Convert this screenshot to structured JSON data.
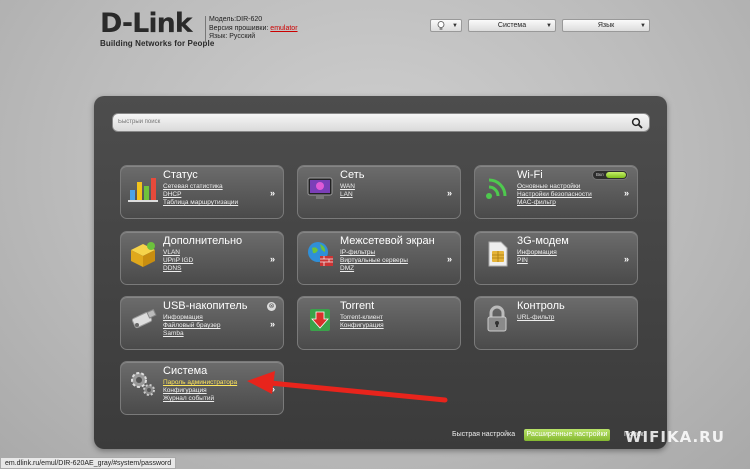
{
  "header": {
    "logo_main": "D-Link",
    "logo_sub": "Building Networks for People",
    "model_line": "Модель:DIR-620",
    "firmware_label": "Версия прошивки: ",
    "firmware_value": "emulator",
    "lang_line": "Язык: Русский"
  },
  "top_controls": {
    "system": "Система",
    "language": "Язык"
  },
  "search": {
    "placeholder": "Быстрый поиск"
  },
  "tiles": [
    {
      "title": "Статус",
      "icon": "status-chart-icon",
      "links": [
        "Сетевая статистика",
        "DHCP",
        "Таблица маршрутизации"
      ]
    },
    {
      "title": "Сеть",
      "icon": "network-monitor-icon",
      "links": [
        "WAN",
        "LAN"
      ]
    },
    {
      "title": "Wi-Fi",
      "icon": "wifi-icon",
      "links": [
        "Основные настройки",
        "Настройки безопасности",
        "MAC-фильтр"
      ],
      "toggle_label": "Вкл"
    },
    {
      "title": "Дополнительно",
      "icon": "advanced-box-icon",
      "links": [
        "VLAN",
        "UPnP IGD",
        "DDNS"
      ]
    },
    {
      "title": "Межсетевой экран",
      "icon": "firewall-globe-icon",
      "links": [
        "IP-фильтры",
        "Виртуальные серверы",
        "DMZ"
      ]
    },
    {
      "title": "3G-модем",
      "icon": "sim-card-icon",
      "links": [
        "Информация",
        "PIN"
      ]
    },
    {
      "title": "USB-накопитель",
      "icon": "usb-drive-icon",
      "links": [
        "Информация",
        "Файловый браузер",
        "Samba"
      ]
    },
    {
      "title": "Torrent",
      "icon": "torrent-download-icon",
      "links": [
        "Torrent-клиент",
        "Конфигурация"
      ]
    },
    {
      "title": "Контроль",
      "icon": "padlock-icon",
      "links": [
        "URL-фильтр"
      ]
    },
    {
      "title": "Система",
      "icon": "system-gears-icon",
      "links": [
        "Пароль администратора",
        "Конфигурация",
        "Журнал событий"
      ]
    }
  ],
  "bottom": {
    "quick_setup": "Быстрая настройка",
    "advanced": "Расширенные настройки",
    "search": "Поиск"
  },
  "status_url": "em.dlink.ru/emul/DIR-620AE_gray/#system/password",
  "watermark": "WIFIKA.RU",
  "colors": {
    "panel": "#444444",
    "accent_green": "#9ccc3f",
    "arrow_red": "#e8241c",
    "highlight_link": "#ffe65a"
  }
}
